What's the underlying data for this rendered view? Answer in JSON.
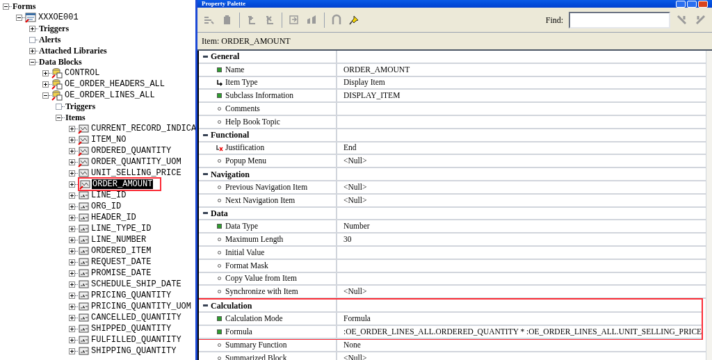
{
  "tree": [
    {
      "label": "Forms",
      "kind": "category",
      "expanded": true,
      "selected": false,
      "children": [
        {
          "label": "XXXOE001",
          "kind": "form",
          "expanded": true,
          "selected": false,
          "children": [
            {
              "label": "Triggers",
              "kind": "category",
              "expanded": false,
              "selected": false
            },
            {
              "label": "Alerts",
              "kind": "category",
              "expandable": false,
              "selected": false
            },
            {
              "label": "Attached Libraries",
              "kind": "category",
              "expanded": false,
              "selected": false
            },
            {
              "label": "Data Blocks",
              "kind": "category",
              "expanded": true,
              "selected": false,
              "children": [
                {
                  "label": "CONTROL",
                  "kind": "block",
                  "expanded": false,
                  "selected": false
                },
                {
                  "label": "OE_ORDER_HEADERS_ALL",
                  "kind": "block",
                  "expanded": false,
                  "selected": false
                },
                {
                  "label": "OE_ORDER_LINES_ALL",
                  "kind": "block",
                  "expanded": true,
                  "selected": false,
                  "children": [
                    {
                      "label": "Triggers",
                      "kind": "category",
                      "expandable": false,
                      "selected": false
                    },
                    {
                      "label": "Items",
                      "kind": "category",
                      "expanded": true,
                      "selected": false,
                      "children": [
                        {
                          "label": "CURRENT_RECORD_INDICA",
                          "kind": "item",
                          "subclassed": true,
                          "expanded": false,
                          "selected": false
                        },
                        {
                          "label": "ITEM_NO",
                          "kind": "item",
                          "subclassed": true,
                          "expanded": false,
                          "selected": false
                        },
                        {
                          "label": "ORDERED_QUANTITY",
                          "kind": "item",
                          "subclassed": true,
                          "expanded": false,
                          "selected": false
                        },
                        {
                          "label": "ORDER_QUANTITY_UOM",
                          "kind": "item",
                          "subclassed": true,
                          "expanded": false,
                          "selected": false
                        },
                        {
                          "label": "UNIT_SELLING_PRICE",
                          "kind": "item",
                          "subclassed": false,
                          "expanded": false,
                          "selected": false
                        },
                        {
                          "label": "ORDER_AMOUNT",
                          "kind": "item",
                          "subclassed": true,
                          "expanded": false,
                          "selected": true,
                          "highlighted": true
                        },
                        {
                          "label": "LINE_ID",
                          "kind": "text-item",
                          "expanded": false,
                          "selected": false
                        },
                        {
                          "label": "ORG_ID",
                          "kind": "text-item",
                          "expanded": false,
                          "selected": false
                        },
                        {
                          "label": "HEADER_ID",
                          "kind": "text-item",
                          "expanded": false,
                          "selected": false
                        },
                        {
                          "label": "LINE_TYPE_ID",
                          "kind": "text-item",
                          "expanded": false,
                          "selected": false
                        },
                        {
                          "label": "LINE_NUMBER",
                          "kind": "text-item",
                          "expanded": false,
                          "selected": false
                        },
                        {
                          "label": "ORDERED_ITEM",
                          "kind": "text-item",
                          "expanded": false,
                          "selected": false
                        },
                        {
                          "label": "REQUEST_DATE",
                          "kind": "text-item",
                          "expanded": false,
                          "selected": false
                        },
                        {
                          "label": "PROMISE_DATE",
                          "kind": "text-item",
                          "expanded": false,
                          "selected": false
                        },
                        {
                          "label": "SCHEDULE_SHIP_DATE",
                          "kind": "text-item",
                          "expanded": false,
                          "selected": false
                        },
                        {
                          "label": "PRICING_QUANTITY",
                          "kind": "text-item",
                          "expanded": false,
                          "selected": false
                        },
                        {
                          "label": "PRICING_QUANTITY_UOM",
                          "kind": "text-item",
                          "expanded": false,
                          "selected": false
                        },
                        {
                          "label": "CANCELLED_QUANTITY",
                          "kind": "text-item",
                          "expanded": false,
                          "selected": false
                        },
                        {
                          "label": "SHIPPED_QUANTITY",
                          "kind": "text-item",
                          "expanded": false,
                          "selected": false
                        },
                        {
                          "label": "FULFILLED_QUANTITY",
                          "kind": "text-item",
                          "expanded": false,
                          "selected": false
                        },
                        {
                          "label": "SHIPPING_QUANTITY",
                          "kind": "text-item",
                          "expanded": false,
                          "selected": false
                        }
                      ]
                    }
                  ]
                }
              ]
            }
          ]
        }
      ]
    }
  ],
  "window": {
    "title": "Property Palette"
  },
  "toolbar": [
    {
      "disabled": true
    },
    {
      "disabled": true
    },
    {
      "disabled": true
    },
    {
      "disabled": true
    },
    {
      "disabled": true
    },
    {
      "disabled": true
    },
    {
      "disabled": true
    },
    {
      "disabled": false
    }
  ],
  "find": {
    "label": "Find:"
  },
  "item_label": "Item: ORDER_AMOUNT",
  "properties": [
    {
      "kind": "section",
      "label": "General"
    },
    {
      "kind": "set-property",
      "label": "Name",
      "value": "ORDER_AMOUNT"
    },
    {
      "kind": "inherited-property",
      "label": "Item Type",
      "value": "Display Item"
    },
    {
      "kind": "set-property",
      "label": "Subclass Information",
      "value": "DISPLAY_ITEM"
    },
    {
      "kind": "default-property",
      "label": "Comments"
    },
    {
      "kind": "default-property",
      "label": "Help Book Topic"
    },
    {
      "kind": "section",
      "label": "Functional"
    },
    {
      "kind": "overridden-property",
      "label": "Justification",
      "value": "End"
    },
    {
      "kind": "default-property",
      "label": "Popup Menu",
      "value": "<Null>"
    },
    {
      "kind": "section",
      "label": "Navigation"
    },
    {
      "kind": "default-property",
      "label": "Previous Navigation Item",
      "value": "<Null>"
    },
    {
      "kind": "default-property",
      "label": "Next Navigation Item",
      "value": "<Null>"
    },
    {
      "kind": "section",
      "label": "Data"
    },
    {
      "kind": "set-property",
      "label": "Data Type",
      "value": "Number"
    },
    {
      "kind": "default-property",
      "label": "Maximum Length",
      "value": "30"
    },
    {
      "kind": "default-property",
      "label": "Initial Value"
    },
    {
      "kind": "default-property",
      "label": "Format Mask"
    },
    {
      "kind": "default-property",
      "label": "Copy Value from Item"
    },
    {
      "kind": "default-property",
      "label": "Synchronize with Item",
      "value": "<Null>"
    },
    {
      "kind": "section",
      "label": "Calculation",
      "highlighted": true
    },
    {
      "kind": "set-property",
      "label": "Calculation Mode",
      "value": "Formula",
      "highlighted": true
    },
    {
      "kind": "set-property",
      "label": "Formula",
      "value": ":OE_ORDER_LINES_ALL.ORDERED_QUANTITY * :OE_ORDER_LINES_ALL.UNIT_SELLING_PRICE",
      "highlighted": true
    },
    {
      "kind": "default-property",
      "label": "Summary Function",
      "value": "None"
    },
    {
      "kind": "default-property",
      "label": "Summarized Block",
      "value": "<Null>"
    }
  ]
}
